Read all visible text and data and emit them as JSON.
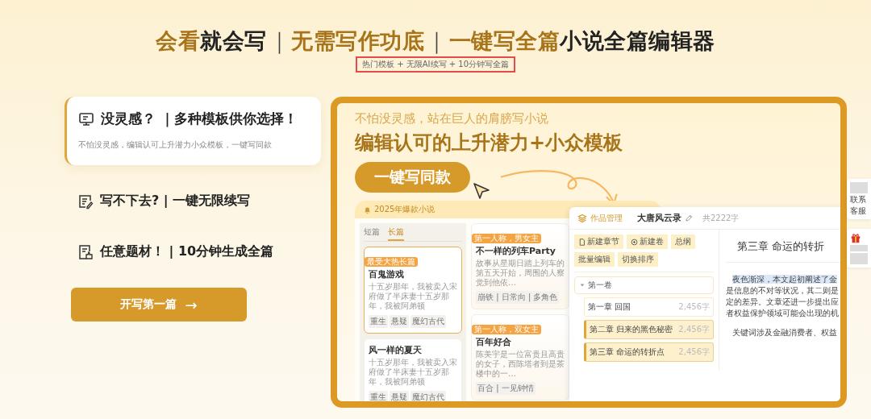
{
  "headline": {
    "segments": [
      {
        "text": "会看",
        "kind": "accent"
      },
      {
        "text": "就会写",
        "kind": "plain"
      },
      {
        "text": "｜",
        "kind": "divider"
      },
      {
        "text": "无需写作功底",
        "kind": "accent"
      },
      {
        "text": "｜",
        "kind": "divider"
      },
      {
        "text": "一键写全篇",
        "kind": "accent"
      },
      {
        "text": "小说全篇编辑器",
        "kind": "plain"
      }
    ],
    "subtitle": "热门模板 + 无限AI续写 + 10分钟写全篇"
  },
  "features": [
    {
      "title": "没灵感？ ｜多种模板供你选择！",
      "description": "不怕没灵感，编辑认可上升潜力小众模板，一键写同款",
      "selected": true
    },
    {
      "title": "写不下去? | 一键无限续写",
      "selected": false
    },
    {
      "title": "任意题材！ | 10分钟生成全篇",
      "selected": false
    }
  ],
  "start_button": {
    "label": "开写第一篇",
    "arrow": "→"
  },
  "showcase": {
    "kicker": "不怕没灵感，站在巨人的肩膀写小说",
    "headline": "编辑认可的上升潜力+小众模板",
    "cta": "一键写同款",
    "library": {
      "title": "2025年爆款小说",
      "tabs": [
        {
          "label": "短篇",
          "selected": false
        },
        {
          "label": "长篇",
          "selected": true
        }
      ],
      "stories": [
        {
          "badge": "最受大热长篇",
          "title": "百鬼游戏",
          "excerpt": "十五岁那年，我被卖入宋府做了半床妻十五岁那年，我被阿弟顿",
          "tags": [
            "重生",
            "悬疑",
            "魔幻古代"
          ],
          "selected": true
        },
        {
          "title": "风一样的夏天",
          "excerpt": "十五岁那年，我被卖入宋府做了半床妻十五岁那年，我被阿弟顿",
          "tags": [
            "重生",
            "悬疑",
            "魔幻古代"
          ],
          "selected": false
        }
      ],
      "templates": [
        {
          "badge": "第一人称，男女主",
          "title": "不一样的列车Party",
          "excerpt": "故事从星期日踏上列车的第五天开始，周围的人察觉到他依…",
          "tags": "崩铁 | 日常向 | 多角色"
        },
        {
          "badge": "第一人称，双女主",
          "title": "百年好合",
          "excerpt": "陈美宇是一位富贵且高贵的女子，西陈塔者到是茶楼中的一…",
          "tags": "百合 | 一见钟情"
        }
      ]
    },
    "editor": {
      "section": "作品管理",
      "work_title": "大唐风云录",
      "word_count": "共2222字",
      "actions": [
        {
          "label": "新建章节"
        },
        {
          "label": "新建卷"
        },
        {
          "label": "总纲"
        },
        {
          "label": "批量编辑"
        },
        {
          "label": "切换排序"
        }
      ],
      "volumes": [
        {
          "label": "第一卷",
          "expanded": true,
          "children": [
            {
              "label": "第一章 回国",
              "count": "2,456字",
              "selected": false
            },
            {
              "label": "第二章 归来的黑色秘密",
              "count": "2,456字",
              "selected": true
            },
            {
              "label": "第三章 命运的转折点",
              "count": "2,456字",
              "selected": true
            }
          ]
        }
      ],
      "chapter_title": "第三章 命运的转折",
      "paragraphs": [
        {
          "lines": [
            {
              "text": "夜色渐深，本文起初阐述了金",
              "highlighted": true
            },
            {
              "text": "是信息的不对等状况，其二则是",
              "highlighted": false
            },
            {
              "text": "定的差异。文章还进一步提出应",
              "highlighted": false
            },
            {
              "text": "者权益保护领域可能会出现的机",
              "highlighted": false
            }
          ]
        },
        {
          "lines": [
            {
              "text": "关键词涉及金融消费者、权益",
              "highlighted": false
            }
          ]
        }
      ]
    }
  },
  "side_widgets": [
    {
      "kind": "contact",
      "lines": [
        "联系",
        "客服"
      ]
    },
    {
      "kind": "gift"
    }
  ]
}
